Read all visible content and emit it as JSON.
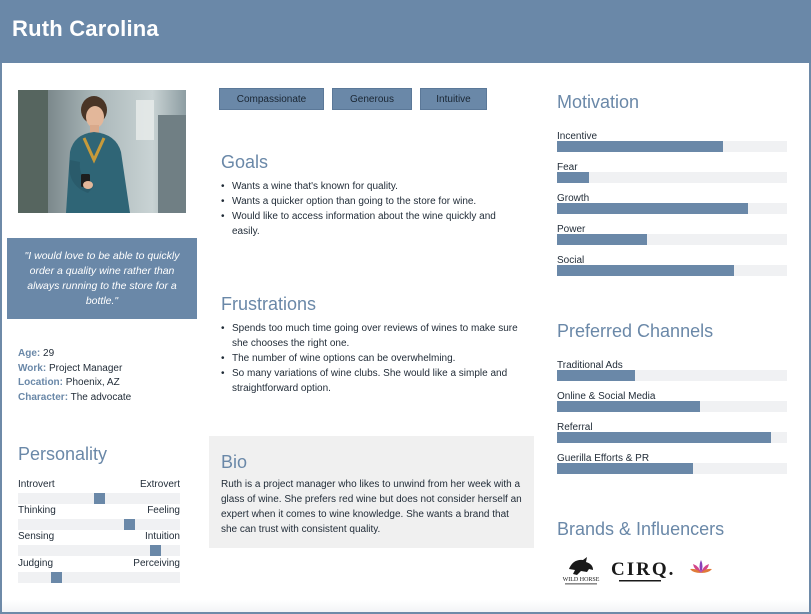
{
  "header": {
    "title": "Ruth Carolina"
  },
  "quote": "\"I would love to be able to quickly order a quality wine rather than always running to the store for a bottle.\"",
  "facts": [
    {
      "key": "Age:",
      "value": "29"
    },
    {
      "key": "Work:",
      "value": "Project Manager"
    },
    {
      "key": "Location:",
      "value": "Phoenix, AZ"
    },
    {
      "key": "Character:",
      "value": "The advocate"
    }
  ],
  "personality": {
    "heading": "Personality",
    "traits": [
      {
        "left": "Introvert",
        "right": "Extrovert",
        "level": 0.5
      },
      {
        "left": "Thinking",
        "right": "Feeling",
        "level": 0.69
      },
      {
        "left": "Sensing",
        "right": "Intuition",
        "level": 0.85
      },
      {
        "left": "Judging",
        "right": "Perceiving",
        "level": 0.24
      }
    ]
  },
  "tags": [
    "Compassionate",
    "Generous",
    "Intuitive"
  ],
  "goals": {
    "heading": "Goals",
    "items": [
      "Wants a wine that's known for quality.",
      "Wants a quicker option than going to the store for wine.",
      "Would like to access information about the wine quickly and easily."
    ]
  },
  "frustrations": {
    "heading": "Frustrations",
    "items": [
      "Spends too much time going over reviews of wines to make sure she chooses the right one.",
      "The number of wine options can be overwhelming.",
      "So many variations of wine clubs. She would like a simple and straightforward option."
    ]
  },
  "bio": {
    "heading": "Bio",
    "text": "Ruth is a project manager who likes to unwind from her week with a glass of wine. She prefers red wine but does not consider herself an expert when it comes to wine knowledge. She wants a brand that she can trust with consistent quality."
  },
  "motivation": {
    "heading": "Motivation",
    "items": [
      {
        "label": "Incentive",
        "level": 0.72
      },
      {
        "label": "Fear",
        "level": 0.14
      },
      {
        "label": "Growth",
        "level": 0.83
      },
      {
        "label": "Power",
        "level": 0.39
      },
      {
        "label": "Social",
        "level": 0.77
      }
    ]
  },
  "channels": {
    "heading": "Preferred Channels",
    "items": [
      {
        "label": "Traditional Ads",
        "level": 0.34
      },
      {
        "label": "Online & Social Media",
        "level": 0.62
      },
      {
        "label": "Referral",
        "level": 0.93
      },
      {
        "label": "Guerilla Efforts & PR",
        "level": 0.59
      }
    ]
  },
  "brands": {
    "heading": "Brands & Influencers",
    "logos": [
      {
        "name": "wild-horse-logo",
        "text": "WILD HORSE"
      },
      {
        "name": "cirq-logo",
        "text": "CIRQ."
      },
      {
        "name": "lotus-logo",
        "text": ""
      }
    ]
  },
  "colors": {
    "accent": "#6a88a8",
    "track": "#f0f1f3",
    "bio_bg": "#f0f0f0"
  }
}
